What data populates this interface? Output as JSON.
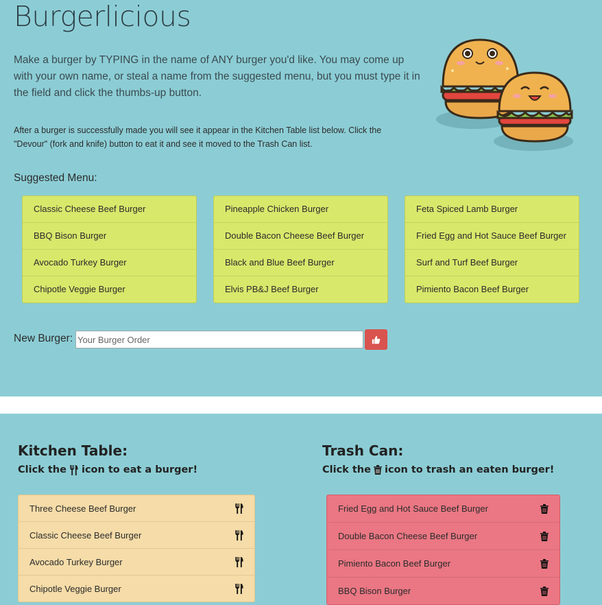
{
  "app": {
    "title": "Burgerlicious",
    "intro": "Make a burger by TYPING in the name of ANY burger you'd like. You may come up with your own name, or steal a name from the suggested menu, but you must type it in the field and click the thumbs-up button.",
    "note": "After a burger is successfully made you will see it appear in the Kitchen Table list below. Click the \"Devour\" (fork and knife) button to eat it and see it moved to the Trash Can list."
  },
  "menu": {
    "label": "Suggested Menu:",
    "columns": [
      [
        "Classic Cheese Beef Burger",
        "BBQ Bison Burger",
        "Avocado Turkey Burger",
        "Chipotle Veggie Burger"
      ],
      [
        "Pineapple Chicken Burger",
        "Double Bacon Cheese Beef Burger",
        "Black and Blue Beef Burger",
        "Elvis PB&J Beef Burger"
      ],
      [
        "Feta Spiced Lamb Burger",
        "Fried Egg and Hot Sauce Beef Burger",
        "Surf and Turf Beef Burger",
        "Pimiento Bacon Beef Burger"
      ]
    ]
  },
  "form": {
    "label": "New Burger:",
    "placeholder": "Your Burger Order",
    "value": "",
    "submit_icon": "thumbs-up-icon",
    "submit_color": "#d9534f"
  },
  "kitchen": {
    "title": "Kitchen Table:",
    "sub_before": "Click the",
    "sub_after": "icon to eat a burger!",
    "icon": "fork-knife-icon",
    "items": [
      "Three Cheese Beef Burger",
      "Classic Cheese Beef Burger",
      "Avocado Turkey Burger",
      "Chipotle Veggie Burger"
    ]
  },
  "trash": {
    "title": "Trash Can:",
    "sub_before": "Click the",
    "sub_after": "icon to trash an eaten burger!",
    "icon": "trash-icon",
    "items": [
      "Fried Egg and Hot Sauce Beef Burger",
      "Double Bacon Cheese Beef Burger",
      "Pimiento Bacon Beef Burger",
      "BBQ Bison Burger"
    ]
  },
  "colors": {
    "background": "#8ccdd5",
    "menu": "#d8e86b",
    "kitchen": "#f5dca8",
    "trash": "#ea7783"
  }
}
